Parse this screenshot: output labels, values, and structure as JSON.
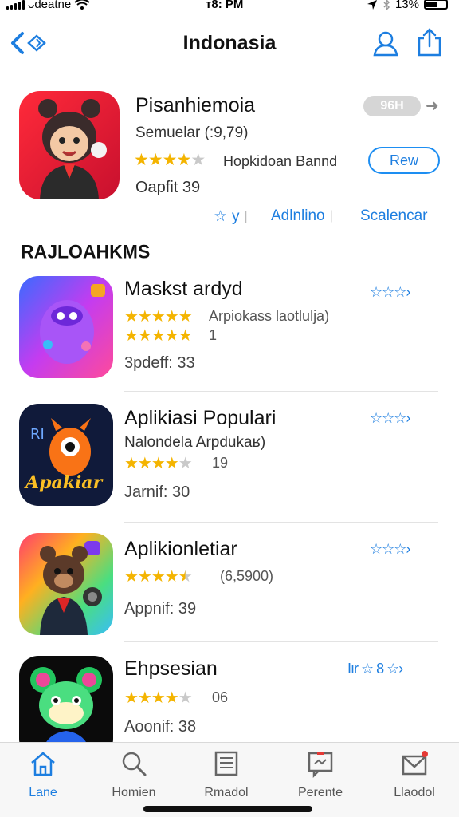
{
  "status_bar": {
    "carrier": "ᴗdeatne",
    "time": "ᴛ8: PM",
    "battery": "13%",
    "icons": [
      "signal-icon",
      "wifi-icon",
      "location-icon",
      "bluetooth-icon",
      "battery-icon"
    ]
  },
  "nav": {
    "title": "Indonasia",
    "back_icon": "back-chevron-icon",
    "profile_icon": "profile-icon",
    "share_icon": "share-icon"
  },
  "featured": {
    "title": "Pisanhiemoia",
    "subtitle": "Semuelar (:9,79)",
    "rating_stars": 4,
    "developer": "Hopkidoan Bannd",
    "meta": "Oapfit 39",
    "size_pill": "96H",
    "get_label": "Rew",
    "actions": [
      "y",
      "Adlnlino",
      "Scalencar"
    ]
  },
  "section": {
    "title": "RAJLOAHKMS"
  },
  "apps": [
    {
      "name": "Maskst ardyd",
      "subtitle": "",
      "stars_row1": 5,
      "rating_text_row1": "Arpiokass laotlulja)",
      "stars_row2": 5,
      "rating_text_row2": "1",
      "meta": "3pdeff: 33",
      "action": "☆☆☆›"
    },
    {
      "name": "Aplikiasi Populari",
      "subtitle": "Nalondela Arpdukaʁ)",
      "stars_row1": 4,
      "rating_text_row1": "19",
      "meta": "Jarnif: 30",
      "action": "☆☆☆›"
    },
    {
      "name": "Aplikionletiar",
      "subtitle": "",
      "stars_row1": 4.5,
      "rating_text_row1": "(6,5900)",
      "meta": "Appnif: 39",
      "action": "☆☆☆›"
    },
    {
      "name": "Ehpsesian",
      "subtitle": "",
      "stars_row1": 4,
      "rating_text_row1": "06",
      "meta": "Aoonif: 38",
      "action": "Iır ☆ 8 ☆›"
    }
  ],
  "tabs": [
    {
      "label": "Lane",
      "icon": "home-icon",
      "active": true
    },
    {
      "label": "Homien",
      "icon": "search-icon",
      "active": false
    },
    {
      "label": "Rmadol",
      "icon": "list-icon",
      "active": false
    },
    {
      "label": "Perente",
      "icon": "message-icon",
      "active": false
    },
    {
      "label": "Llaodol",
      "icon": "mail-icon",
      "active": false
    }
  ],
  "colors": {
    "accent": "#1d7ee0",
    "star": "#f4b400",
    "star_dim": "#c9c9c9",
    "pill": "#d6d6d6"
  }
}
